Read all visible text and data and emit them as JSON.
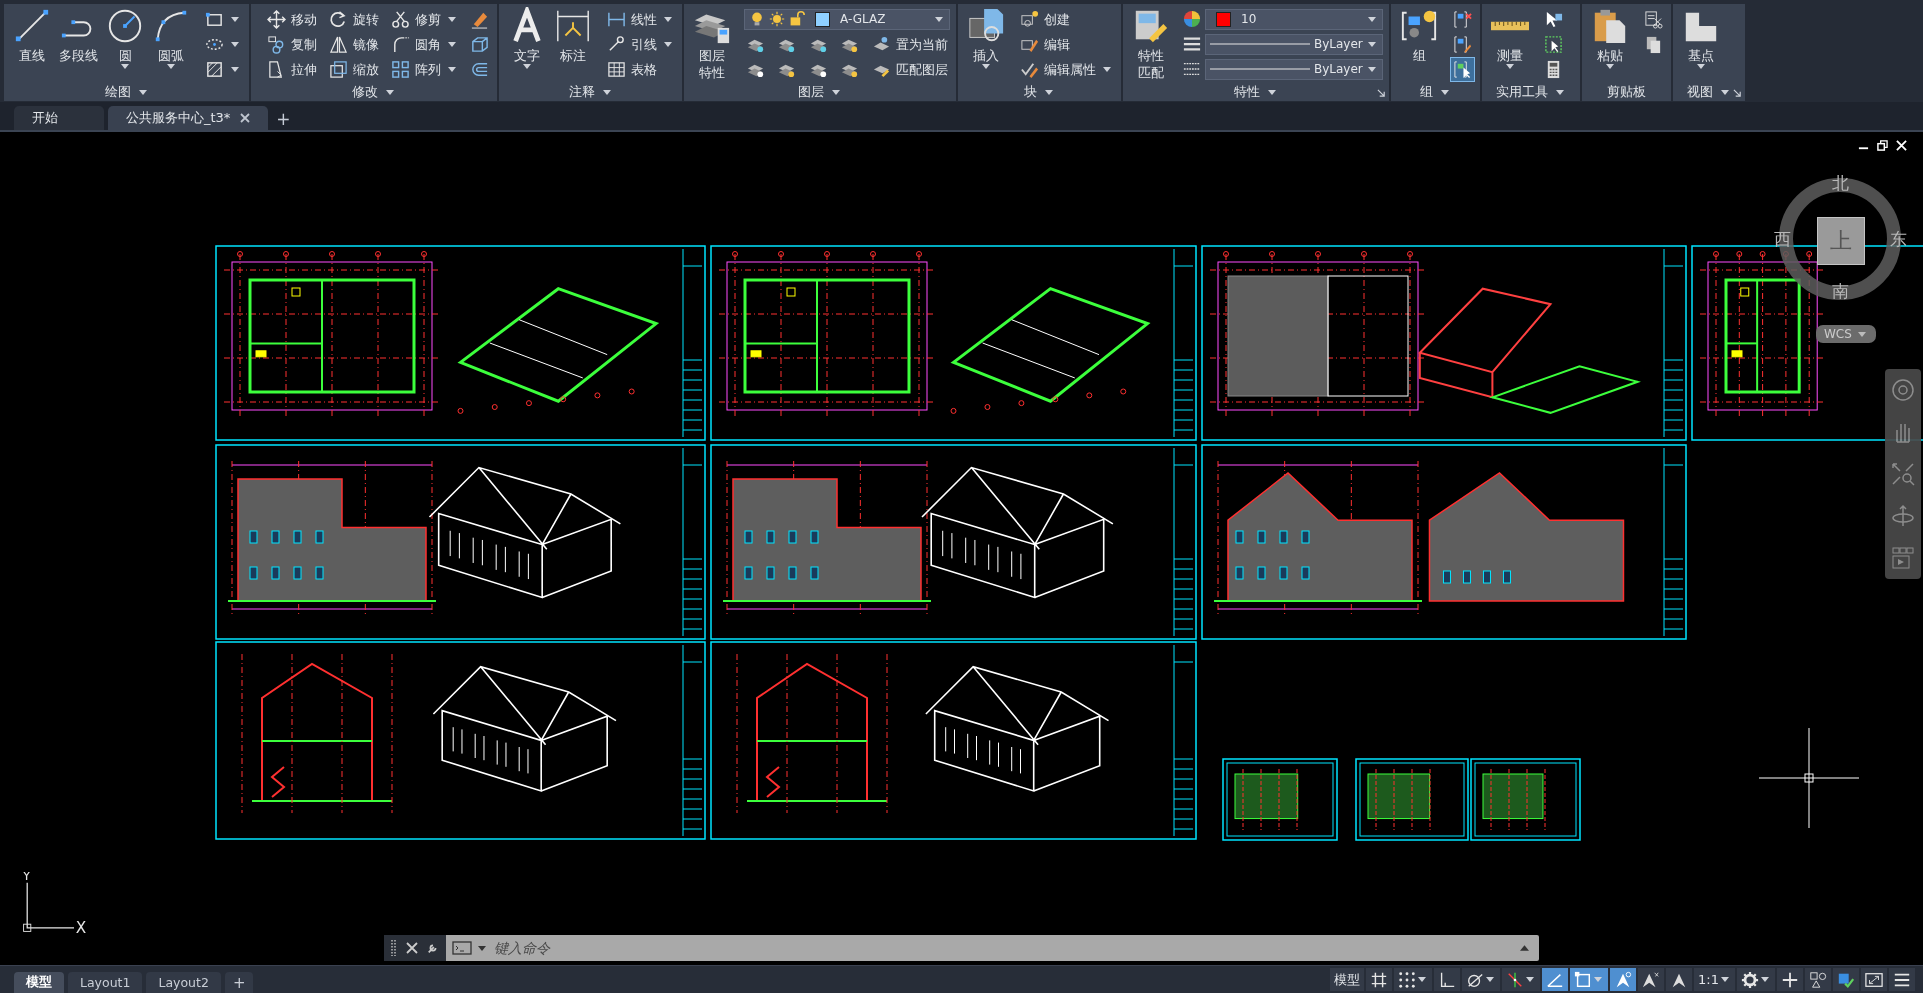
{
  "ribbon": {
    "panels": [
      {
        "title": "绘图",
        "menu": true,
        "launcher": false,
        "large": [
          {
            "label": "直线",
            "dropdown": false
          },
          {
            "label": "多段线",
            "dropdown": false
          },
          {
            "label": "圆",
            "dropdown": true
          },
          {
            "label": "圆弧",
            "dropdown": true
          }
        ],
        "small": [
          {
            "dropdown": true
          },
          {
            "dropdown": true
          },
          {
            "dropdown": true
          }
        ]
      },
      {
        "title": "修改",
        "menu": true,
        "launcher": false,
        "small": [
          {
            "label": "移动",
            "dropdown": false
          },
          {
            "label": "复制",
            "dropdown": false
          },
          {
            "label": "拉伸",
            "dropdown": false
          },
          {
            "label": "旋转",
            "dropdown": false
          },
          {
            "label": "镜像",
            "dropdown": false
          },
          {
            "label": "缩放",
            "dropdown": false
          },
          {
            "label": "修剪",
            "dropdown": true
          },
          {
            "label": "圆角",
            "dropdown": true
          },
          {
            "label": "阵列",
            "dropdown": true
          },
          {
            "dropdown": false
          },
          {
            "dropdown": false
          },
          {
            "dropdown": false
          }
        ]
      },
      {
        "title": "注释",
        "menu": true,
        "launcher": false,
        "large": [
          {
            "label": "文字",
            "dropdown": true
          },
          {
            "label": "标注",
            "dropdown": false
          }
        ],
        "small": [
          {
            "label": "线性",
            "dropdown": true
          },
          {
            "label": "引线",
            "dropdown": true
          },
          {
            "label": "表格",
            "dropdown": false
          }
        ]
      },
      {
        "title": "图层",
        "menu": true,
        "launcher": false,
        "large": [
          {
            "label": "图层特性",
            "dropdown": false
          }
        ],
        "combos": [
          {
            "kind": "layer",
            "value": "A-GLAZ",
            "color": "#8fd0ff"
          }
        ],
        "small": [
          {
            "dropdown": false
          },
          {
            "dropdown": false
          },
          {
            "dropdown": false
          },
          {
            "dropdown": false
          },
          {
            "dropdown": false
          },
          {
            "dropdown": false
          },
          {
            "dropdown": false
          },
          {
            "dropdown": false
          },
          {
            "label": "置为当前",
            "dropdown": false
          },
          {
            "label": "匹配图层",
            "dropdown": false
          }
        ]
      },
      {
        "title": "块",
        "menu": true,
        "launcher": false,
        "large": [
          {
            "label": "插入",
            "dropdown": true
          }
        ],
        "small": [
          {
            "label": "创建",
            "dropdown": false
          },
          {
            "label": "编辑",
            "dropdown": false
          },
          {
            "label": "编辑属性",
            "dropdown": true
          }
        ]
      },
      {
        "title": "特性",
        "menu": true,
        "launcher": true,
        "large": [
          {
            "label": "特性匹配",
            "dropdown": false
          }
        ],
        "combos": [
          {
            "kind": "color",
            "value": "10",
            "color": "#ff0000"
          },
          {
            "kind": "linetype",
            "value": "ByLayer"
          },
          {
            "kind": "lineweight",
            "value": "ByLayer"
          }
        ]
      },
      {
        "title": "组",
        "menu": true,
        "launcher": false,
        "large": [
          {
            "label": "组",
            "dropdown": false
          }
        ],
        "small": [
          {
            "dropdown": false,
            "on": false
          },
          {
            "dropdown": false,
            "on": false
          },
          {
            "dropdown": false,
            "on": true
          }
        ]
      },
      {
        "title": "实用工具",
        "menu": true,
        "launcher": false,
        "large": [
          {
            "label": "测量",
            "dropdown": true
          }
        ],
        "small": [
          {
            "dropdown": false
          },
          {
            "dropdown": false
          },
          {
            "dropdown": false
          }
        ]
      },
      {
        "title": "剪贴板",
        "menu": false,
        "launcher": false,
        "large": [
          {
            "label": "粘贴",
            "dropdown": true
          }
        ],
        "small": [
          {
            "dropdown": false
          },
          {
            "dropdown": false
          }
        ]
      },
      {
        "title": "视图",
        "menu": true,
        "launcher": true,
        "large": [
          {
            "label": "基点",
            "dropdown": true
          }
        ]
      }
    ]
  },
  "file_tabs": [
    {
      "label": "开始",
      "selected": false,
      "closable": false
    },
    {
      "label": "公共服务中心_t3*",
      "selected": true,
      "closable": true
    }
  ],
  "new_tab": "+",
  "viewcube": {
    "north": "北",
    "west": "西",
    "east": "东",
    "south": "南",
    "top": "上",
    "ucs": "WCS"
  },
  "ucs_icon": {
    "x": "X",
    "y": "Y"
  },
  "command_line": {
    "placeholder": "键入命令"
  },
  "layout_tabs": [
    {
      "label": "模型",
      "selected": true
    },
    {
      "label": "Layout1",
      "selected": false
    },
    {
      "label": "Layout2",
      "selected": false
    }
  ],
  "new_layout": "+",
  "status_bar": [
    {
      "label": "模型",
      "on": false,
      "dropdown": false
    },
    {
      "on": false,
      "dropdown": false
    },
    {
      "on": false,
      "dropdown": true
    },
    {
      "on": false,
      "dropdown": false
    },
    {
      "on": false,
      "dropdown": true
    },
    {
      "on": false,
      "dropdown": true
    },
    {
      "on": true,
      "dropdown": false
    },
    {
      "on": true,
      "dropdown": true
    },
    {
      "on": true,
      "dropdown": false
    },
    {
      "on": false,
      "dropdown": false
    },
    {
      "on": false,
      "dropdown": false
    },
    {
      "label": "1:1",
      "on": false,
      "dropdown": true
    },
    {
      "on": false,
      "dropdown": true
    },
    {
      "on": false,
      "dropdown": false
    },
    {
      "on": false,
      "dropdown": false
    },
    {
      "on": false,
      "dropdown": false
    },
    {
      "on": false,
      "dropdown": false
    },
    {
      "on": false,
      "dropdown": false
    }
  ]
}
